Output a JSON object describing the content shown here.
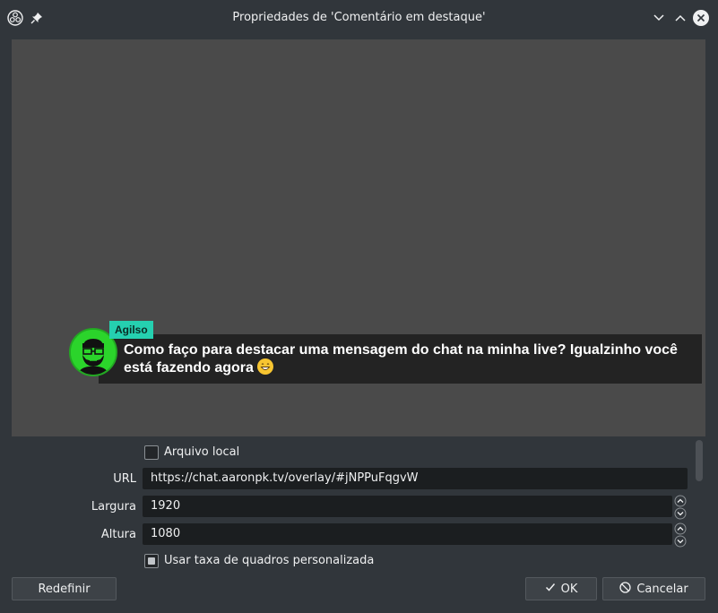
{
  "window": {
    "title": "Propriedades de 'Comentário em destaque'"
  },
  "preview": {
    "chat_name": "Agilso",
    "chat_message": "Como faço para destacar uma mensagem do chat na minha live? Igualzinho você está fazendo agora"
  },
  "form": {
    "local_file_label": "Arquivo local",
    "local_file_checked": false,
    "url_label": "URL",
    "url_value": "https://chat.aaronpk.tv/overlay/#jNPPuFqgvW",
    "width_label": "Largura",
    "width_value": "1920",
    "height_label": "Altura",
    "height_value": "1080",
    "custom_fps_label": "Usar taxa de quadros personalizada",
    "custom_fps_checked": true
  },
  "buttons": {
    "reset_label": "Redefinir",
    "ok_label": "OK",
    "cancel_label": "Cancelar"
  },
  "colors": {
    "name_tag": "#25d0b0",
    "avatar": "#2bd42b"
  }
}
